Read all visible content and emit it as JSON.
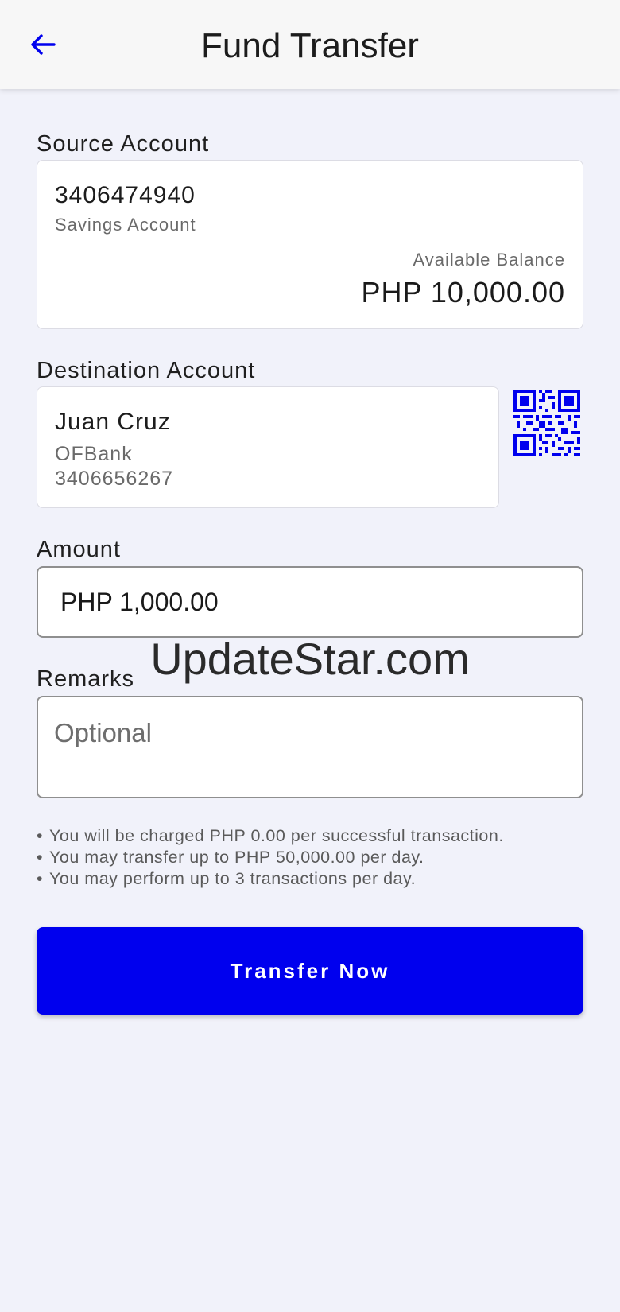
{
  "header": {
    "title": "Fund Transfer",
    "back_icon": "arrow-left-icon"
  },
  "colors": {
    "accent": "#0000ee",
    "background": "#f1f2fa",
    "card": "#ffffff"
  },
  "source": {
    "label": "Source Account",
    "account_number": "3406474940",
    "account_type": "Savings Account",
    "balance_label": "Available Balance",
    "balance_value": "PHP 10,000.00"
  },
  "destination": {
    "label": "Destination Account",
    "name": "Juan Cruz",
    "bank": "OFBank",
    "account_number": "3406656267",
    "qr_icon": "qr-code-icon"
  },
  "amount": {
    "label": "Amount",
    "value": "PHP 1,000.00"
  },
  "remarks": {
    "label": "Remarks",
    "placeholder": "Optional",
    "value": ""
  },
  "watermark": "UpdateStar.com",
  "notes": [
    "You will be charged PHP 0.00 per successful transaction.",
    "You may transfer up to PHP 50,000.00 per day.",
    "You may perform up to 3 transactions per day."
  ],
  "actions": {
    "transfer_label": "Transfer Now"
  }
}
